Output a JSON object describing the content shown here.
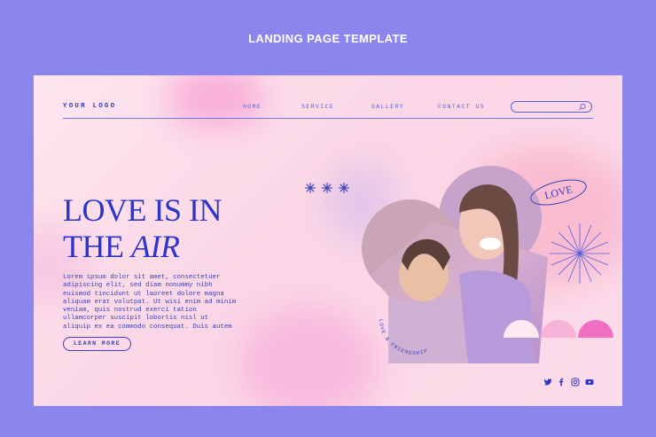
{
  "page_title": "LANDING PAGE TEMPLATE",
  "header": {
    "logo": "YOUR LOGO",
    "nav": [
      "HOME",
      "SERVICE",
      "GALLERY",
      "CONTACT US"
    ],
    "search_icon": "search-icon"
  },
  "hero": {
    "headline_line1": "LOVE IS IN",
    "headline_line2_plain": "THE ",
    "headline_line2_italic": "AIR",
    "body": "Lorem ipsum dolor sit amet, consectetuer\nadipiscing elit, sed diam nonummy nibh\neuismod tincidunt ut laoreet dolore magna\naliquam erat volutpat. Ut wisi enim ad minim\nveniam, quis nostrud exerci tation\nullamcorper suscipit lobortis nisl ut\naliquip ex ea commodo consequat. Duis autem",
    "cta": "LEARN MORE"
  },
  "decor": {
    "badge_text": "LOVE",
    "circular_text": "LOVE & FRIENDSHIP"
  },
  "social": [
    "twitter-icon",
    "facebook-icon",
    "instagram-icon",
    "youtube-icon"
  ],
  "colors": {
    "background": "#8b86ee",
    "accent": "#2d35c9",
    "card": "#fbd6e6"
  }
}
